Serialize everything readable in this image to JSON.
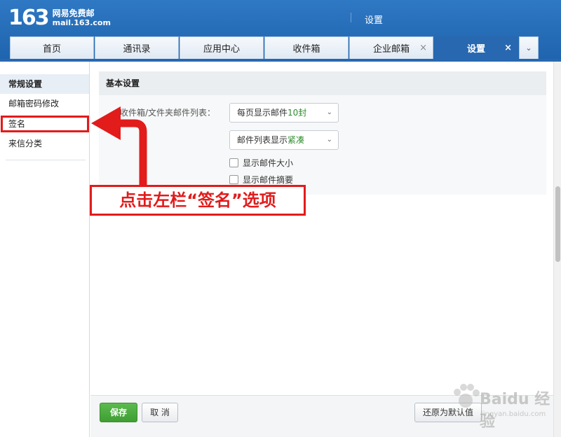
{
  "header": {
    "logo_number": "163",
    "logo_line1": "网易免费邮",
    "logo_line2": "mail.163.com",
    "title": "设置"
  },
  "tabs": [
    {
      "label": "首页",
      "closable": false,
      "active": false
    },
    {
      "label": "通讯录",
      "closable": false,
      "active": false
    },
    {
      "label": "应用中心",
      "closable": false,
      "active": false
    },
    {
      "label": "收件箱",
      "closable": false,
      "active": false
    },
    {
      "label": "企业邮箱",
      "closable": true,
      "active": false
    },
    {
      "label": "设置",
      "closable": true,
      "active": true
    }
  ],
  "tab_close_glyph": "×",
  "tab_more_glyph": "⌄",
  "sidebar": {
    "items": [
      {
        "label": "常规设置"
      },
      {
        "label": "邮箱密码修改"
      },
      {
        "label": "签名"
      },
      {
        "label": "来信分类"
      }
    ]
  },
  "main": {
    "section_title": "基本设置",
    "field_label": "收件箱/文件夹邮件列表：",
    "select_per_page_prefix": "每页显示邮件",
    "select_per_page_value": "10封",
    "select_density_prefix": "邮件列表显示",
    "select_density_value": "紧凑",
    "check_size_label": "显示邮件大小",
    "check_summary_label": "显示邮件摘要",
    "check_size_checked": false,
    "check_summary_checked": false
  },
  "footer": {
    "save_label": "保存",
    "cancel_label": "取 消",
    "reset_label": "还原为默认值"
  },
  "annotation": {
    "text": "点击左栏“签名”选项",
    "color": "#e21b1b"
  },
  "watermark": {
    "main": "Baidu 经验",
    "sub": "jingyan.baidu.com"
  },
  "colors": {
    "header_blue": "#2868b0",
    "save_green": "#4caf3f",
    "highlight_green": "#2e8b2e"
  }
}
